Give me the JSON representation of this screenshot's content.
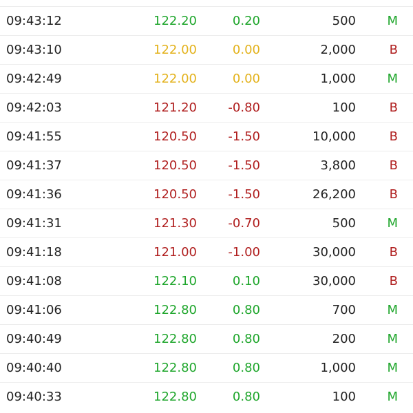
{
  "colors": {
    "up": "#1fa62c",
    "flat": "#e3b21c",
    "down": "#b01f1f",
    "text": "#222222",
    "divider": "#ececec"
  },
  "trades": [
    {
      "time": "09:43:12",
      "price": "122.20",
      "change": "0.20",
      "volume": "500",
      "side": "M",
      "trend": "up",
      "side_color": "up"
    },
    {
      "time": "09:43:10",
      "price": "122.00",
      "change": "0.00",
      "volume": "2,000",
      "side": "B",
      "trend": "flat",
      "side_color": "down"
    },
    {
      "time": "09:42:49",
      "price": "122.00",
      "change": "0.00",
      "volume": "1,000",
      "side": "M",
      "trend": "flat",
      "side_color": "up"
    },
    {
      "time": "09:42:03",
      "price": "121.20",
      "change": "-0.80",
      "volume": "100",
      "side": "B",
      "trend": "down",
      "side_color": "down"
    },
    {
      "time": "09:41:55",
      "price": "120.50",
      "change": "-1.50",
      "volume": "10,000",
      "side": "B",
      "trend": "down",
      "side_color": "down"
    },
    {
      "time": "09:41:37",
      "price": "120.50",
      "change": "-1.50",
      "volume": "3,800",
      "side": "B",
      "trend": "down",
      "side_color": "down"
    },
    {
      "time": "09:41:36",
      "price": "120.50",
      "change": "-1.50",
      "volume": "26,200",
      "side": "B",
      "trend": "down",
      "side_color": "down"
    },
    {
      "time": "09:41:31",
      "price": "121.30",
      "change": "-0.70",
      "volume": "500",
      "side": "M",
      "trend": "down",
      "side_color": "up"
    },
    {
      "time": "09:41:18",
      "price": "121.00",
      "change": "-1.00",
      "volume": "30,000",
      "side": "B",
      "trend": "down",
      "side_color": "down"
    },
    {
      "time": "09:41:08",
      "price": "122.10",
      "change": "0.10",
      "volume": "30,000",
      "side": "B",
      "trend": "up",
      "side_color": "down"
    },
    {
      "time": "09:41:06",
      "price": "122.80",
      "change": "0.80",
      "volume": "700",
      "side": "M",
      "trend": "up",
      "side_color": "up"
    },
    {
      "time": "09:40:49",
      "price": "122.80",
      "change": "0.80",
      "volume": "200",
      "side": "M",
      "trend": "up",
      "side_color": "up"
    },
    {
      "time": "09:40:40",
      "price": "122.80",
      "change": "0.80",
      "volume": "1,000",
      "side": "M",
      "trend": "up",
      "side_color": "up"
    },
    {
      "time": "09:40:33",
      "price": "122.80",
      "change": "0.80",
      "volume": "100",
      "side": "M",
      "trend": "up",
      "side_color": "up"
    }
  ]
}
